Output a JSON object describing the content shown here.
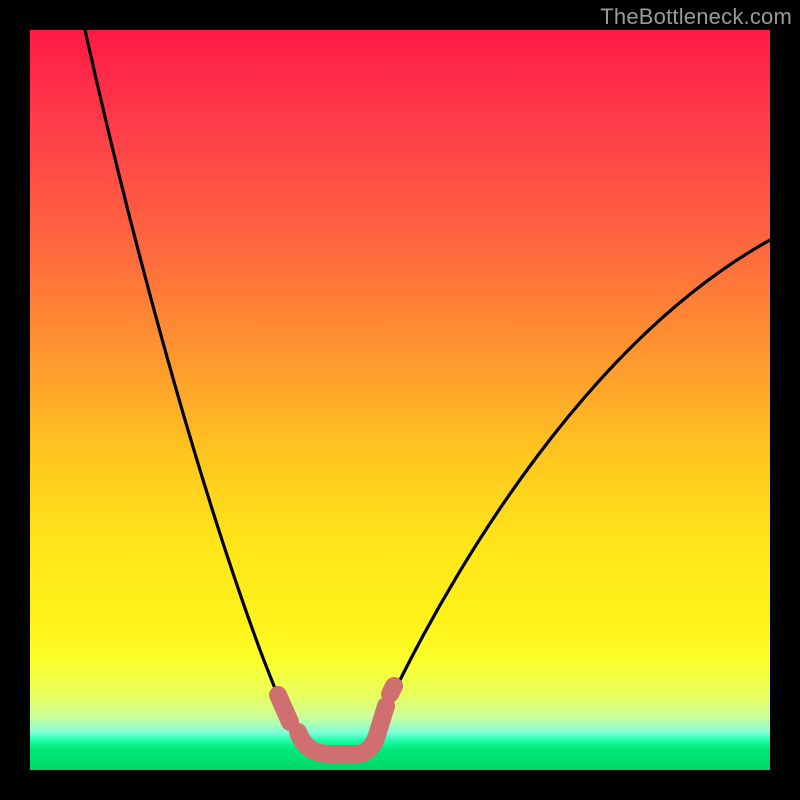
{
  "watermark": {
    "text": "TheBottleneck.com"
  },
  "chart_data": {
    "type": "line",
    "title": "",
    "xlabel": "",
    "ylabel": "",
    "xlim": [
      0,
      100
    ],
    "ylim": [
      0,
      100
    ],
    "series": [
      {
        "name": "bottleneck-curve",
        "x": [
          5,
          10,
          15,
          20,
          25,
          28,
          30,
          32,
          34,
          36,
          38,
          40,
          42,
          44,
          46,
          50,
          55,
          60,
          65,
          70,
          75,
          80,
          85,
          90,
          95,
          100
        ],
        "y": [
          100,
          83,
          67,
          52,
          38,
          30,
          24,
          18,
          12,
          7,
          4,
          3,
          3,
          3,
          4,
          7,
          12,
          18,
          24,
          30,
          36,
          42,
          48,
          53,
          58,
          62
        ]
      }
    ],
    "annotations": [
      {
        "name": "valley-highlight",
        "x_range": [
          34,
          48
        ],
        "y": 3,
        "color": "#cf6f6f"
      }
    ],
    "background_gradient": {
      "stops": [
        {
          "pos": 0.0,
          "color": "#ff1a44"
        },
        {
          "pos": 0.5,
          "color": "#ffb020"
        },
        {
          "pos": 0.8,
          "color": "#fff21a"
        },
        {
          "pos": 0.95,
          "color": "#7affd8"
        },
        {
          "pos": 1.0,
          "color": "#00d868"
        }
      ]
    }
  }
}
